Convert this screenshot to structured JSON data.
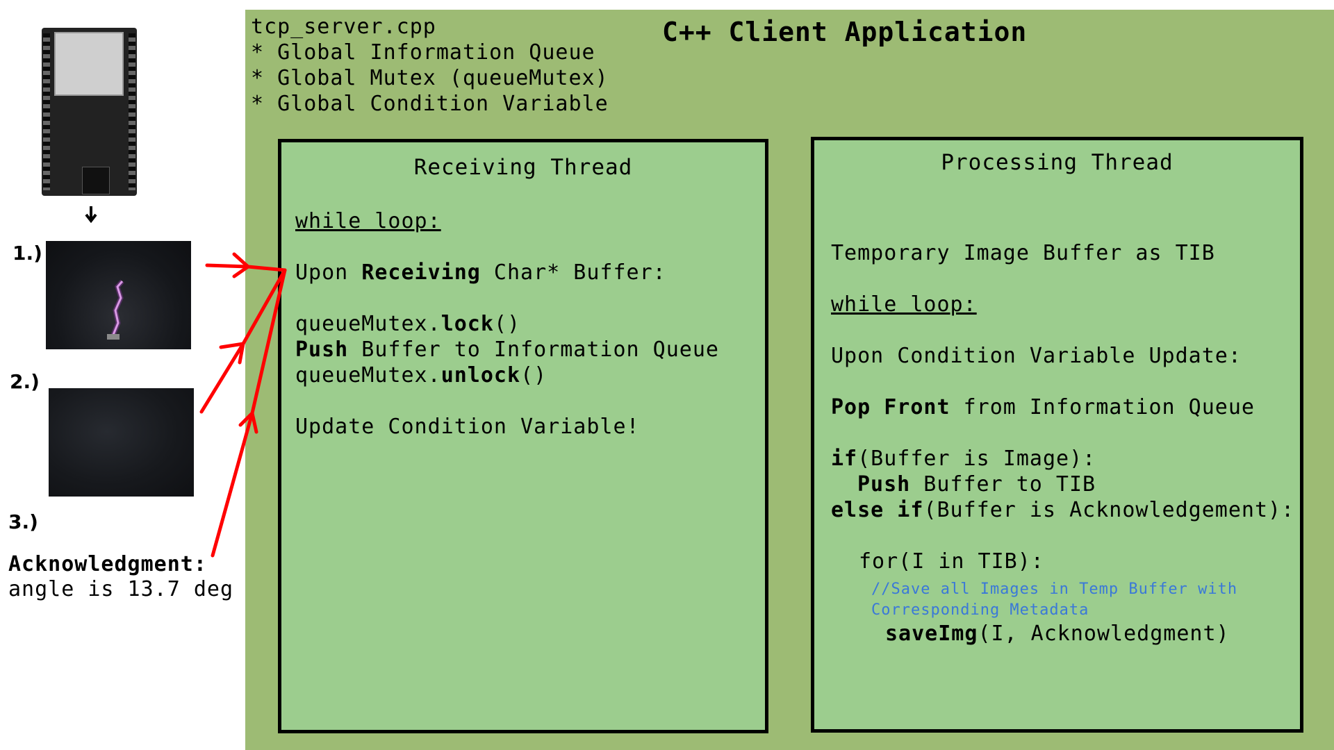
{
  "app": {
    "title": "C++ Client Application",
    "file_name": "tcp_server.cpp",
    "globals": [
      "* Global Information Queue",
      "* Global Mutex (queueMutex)",
      "* Global Condition Variable"
    ]
  },
  "receiving_thread": {
    "title": "Receiving Thread",
    "while_loop": "while loop:",
    "upon_prefix": "Upon ",
    "upon_kw": "Receiving",
    "upon_suffix": " Char* Buffer:",
    "lock_obj": "queueMutex.",
    "lock_kw": "lock",
    "lock_parens": "()",
    "push_kw": "Push",
    "push_rest": " Buffer to Information Queue",
    "unlock_obj": "queueMutex.",
    "unlock_kw": "unlock",
    "unlock_parens": "()",
    "update_cv": "Update Condition Variable!"
  },
  "processing_thread": {
    "title": "Processing Thread",
    "tib_decl": "Temporary Image Buffer as TIB",
    "while_loop": "while loop:",
    "upon_cv": "Upon Condition Variable Update:",
    "pop_kw": "Pop Front",
    "pop_rest": " from Information Queue",
    "if_kw": "if",
    "if_rest": "(Buffer is Image):",
    "push_kw": "Push",
    "push_rest": " Buffer to TIB",
    "elseif_kw": "else if",
    "elseif_rest": "(Buffer is Acknowledgement):",
    "for_line": "for(I in TIB):",
    "comment_1": "//Save all Images in Temp Buffer with",
    "comment_2": "Corresponding Metadata",
    "save_kw": "saveImg",
    "save_rest": "(I, Acknowledgment)"
  },
  "inputs": {
    "label_1": "1.)",
    "label_2": "2.)",
    "label_3": "3.)",
    "ack_title": "Acknowledgment:",
    "ack_value": "angle is 13.7 deg"
  },
  "colors": {
    "panel": "#9dbb74",
    "thread_box": "#9ccd8e",
    "arrow": "#ff0000",
    "comment": "#3a78d8"
  }
}
